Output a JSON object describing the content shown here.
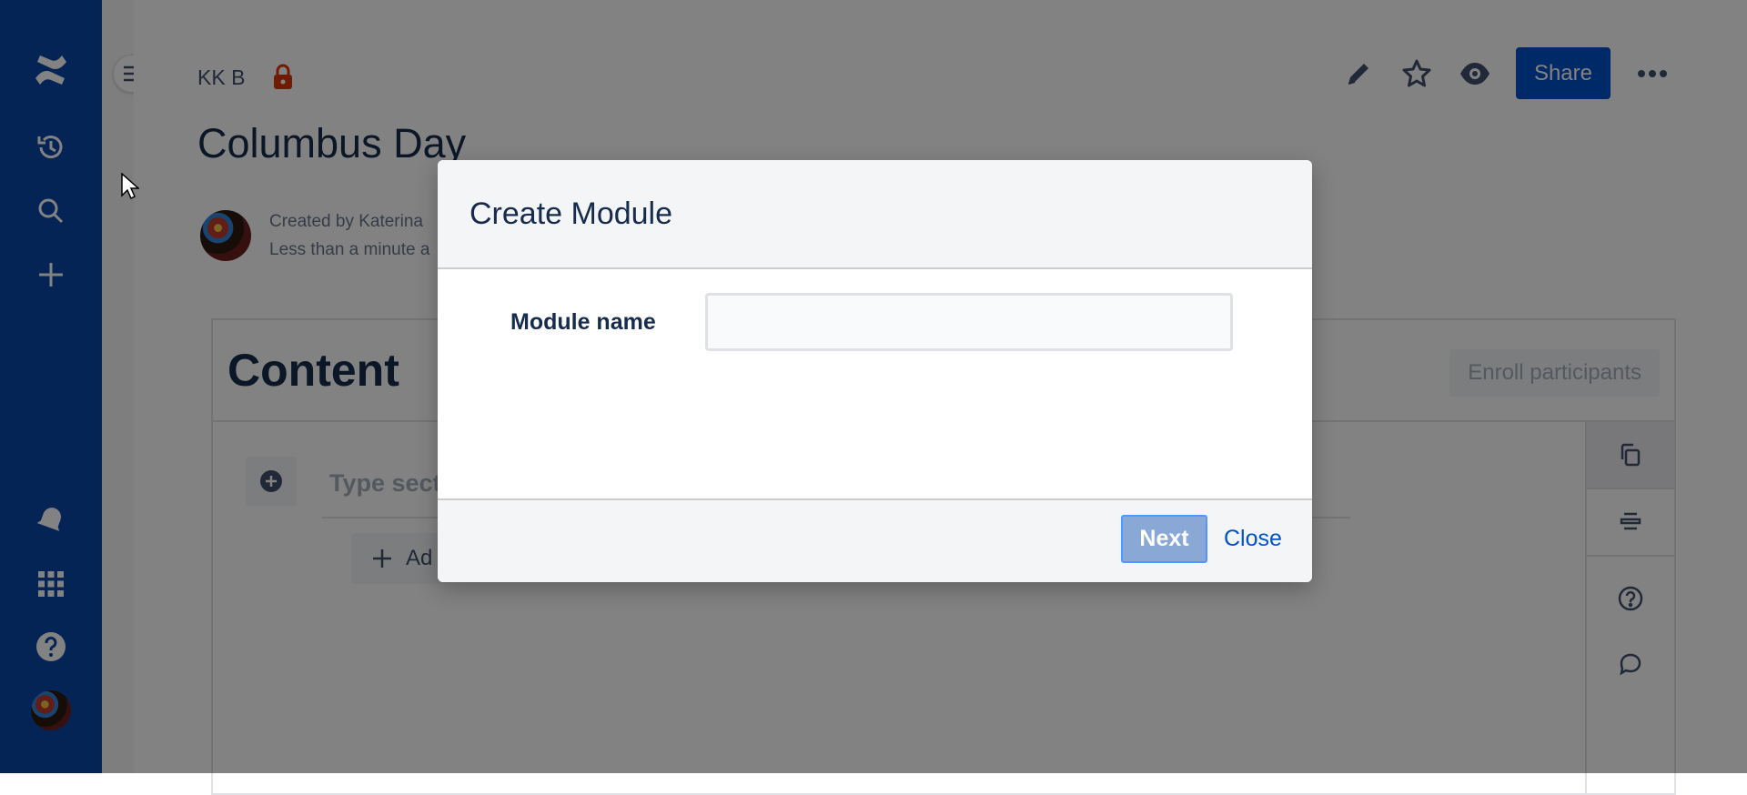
{
  "breadcrumb": {
    "space": "KK B"
  },
  "page": {
    "title": "Columbus Day",
    "byline_created": "Created by Katerina",
    "byline_time": "Less than a minute a"
  },
  "toolbar": {
    "share_label": "Share"
  },
  "content_macro": {
    "title": "Content",
    "enroll_label": "Enroll participants",
    "section_placeholder": "Type sect",
    "add_label": "Ad"
  },
  "dialog": {
    "title": "Create Module",
    "field_label": "Module name",
    "field_value": "",
    "next_label": "Next",
    "close_label": "Close"
  },
  "colors": {
    "nav_bg": "#0747a6",
    "primary": "#0052cc",
    "lock": "#de350b",
    "next_disabled": "#8aa8d6"
  }
}
